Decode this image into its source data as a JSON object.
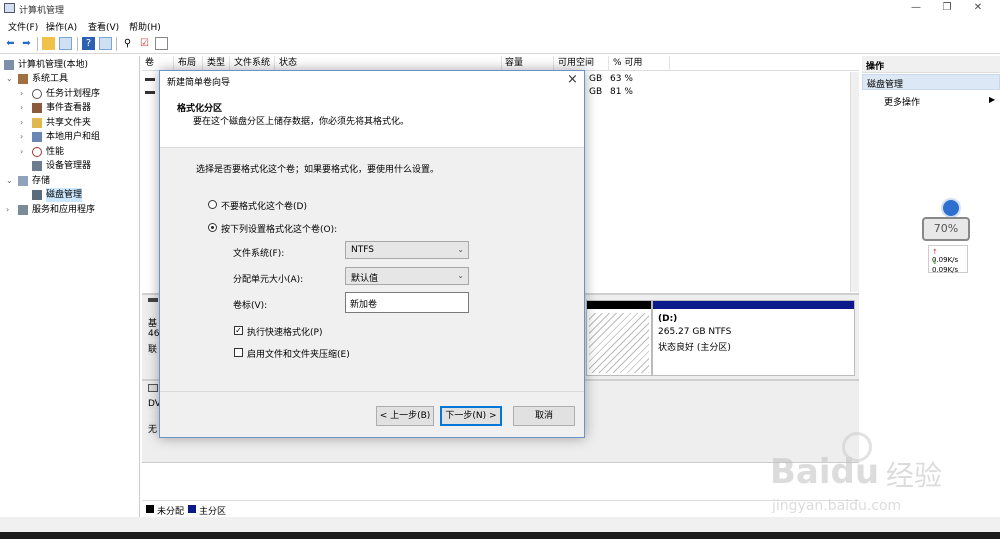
{
  "window": {
    "title": "计算机管理",
    "minimize": "—",
    "maximize": "❐",
    "close": "✕"
  },
  "menu": {
    "items": [
      "文件(F)",
      "操作(A)",
      "查看(V)",
      "帮助(H)"
    ]
  },
  "tree": {
    "root": "计算机管理(本地)",
    "items": [
      {
        "label": "系统工具",
        "icon": "tools-icon"
      },
      {
        "label": "任务计划程序",
        "icon": "clock-icon"
      },
      {
        "label": "事件查看器",
        "icon": "event-viewer-icon"
      },
      {
        "label": "共享文件夹",
        "icon": "shared-folder-icon"
      },
      {
        "label": "本地用户和组",
        "icon": "users-icon"
      },
      {
        "label": "性能",
        "icon": "performance-icon"
      },
      {
        "label": "设备管理器",
        "icon": "device-manager-icon"
      },
      {
        "label": "存储",
        "icon": "storage-icon"
      },
      {
        "label": "磁盘管理",
        "icon": "disk-management-icon"
      },
      {
        "label": "服务和应用程序",
        "icon": "services-icon"
      }
    ]
  },
  "volumes": {
    "columns": [
      "卷",
      "布局",
      "类型",
      "文件系统",
      "状态",
      "容量",
      "可用空间",
      "% 可用"
    ],
    "rows": [
      {
        "space": "GB",
        "pct": "63 %"
      },
      {
        "space": "GB",
        "pct": "81 %"
      }
    ]
  },
  "disks": {
    "disk0": {
      "l1": "基",
      "l2": "46",
      "l3": "联"
    },
    "d_partition": {
      "name": "(D:)",
      "size": "265.27 GB NTFS",
      "status": "状态良好 (主分区)"
    },
    "dvd": {
      "l1": "DV",
      "l2": "无"
    }
  },
  "legend": {
    "unallocated": "未分配",
    "primary": "主分区"
  },
  "actions": {
    "header": "操作",
    "section": "磁盘管理",
    "more": "更多操作"
  },
  "widget": {
    "percent": "70%",
    "up": "0.09K/s",
    "down": "0.09K/s"
  },
  "dialog": {
    "title": "新建简单卷向导",
    "heading": "格式化分区",
    "subheading": "要在这个磁盘分区上储存数据，你必须先将其格式化。",
    "prompt": "选择是否要格式化这个卷；如果要格式化，要使用什么设置。",
    "no_format": "不要格式化这个卷(D)",
    "format": "按下列设置格式化这个卷(O):",
    "fs_label": "文件系统(F):",
    "fs_value": "NTFS",
    "alloc_label": "分配单元大小(A):",
    "alloc_value": "默认值",
    "vol_label": "卷标(V):",
    "vol_value": "新加卷",
    "quick_format": "执行快速格式化(P)",
    "compression": "启用文件和文件夹压缩(E)",
    "back": "< 上一步(B)",
    "next": "下一步(N) >",
    "cancel": "取消"
  },
  "watermark": {
    "brand": "Bai",
    "brand2": "du",
    "cn": "经验",
    "url": "jingyan.baidu.com"
  }
}
